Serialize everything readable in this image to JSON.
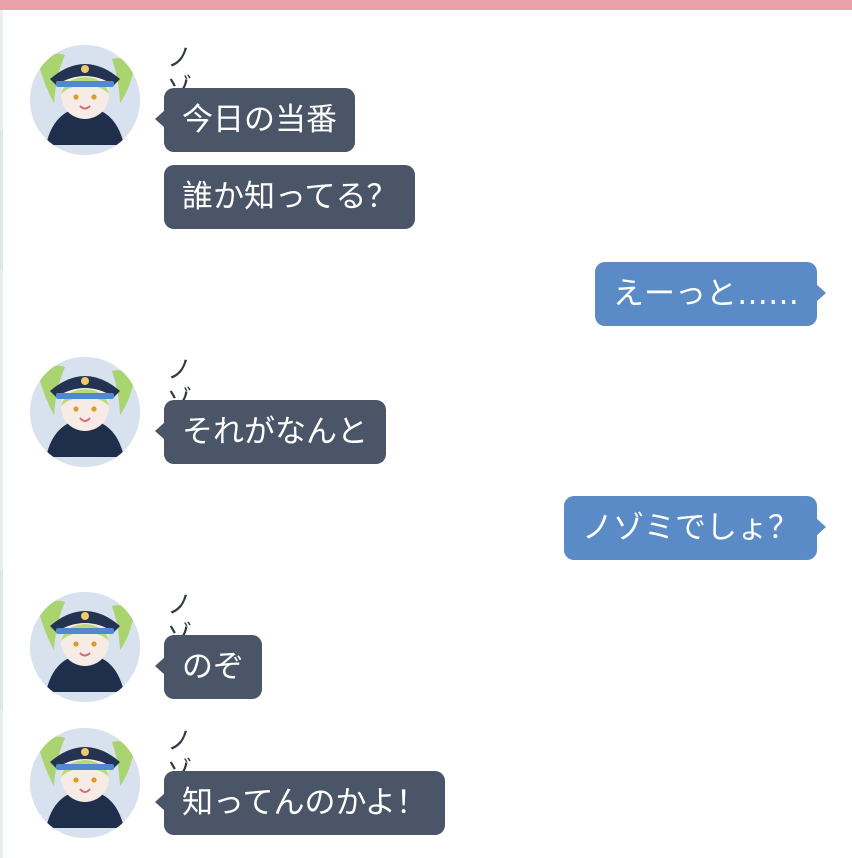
{
  "sender_name": "ノゾミ",
  "messages": [
    {
      "from": "other",
      "text": "今日の当番"
    },
    {
      "from": "other",
      "text": "誰か知ってる？"
    },
    {
      "from": "me",
      "text": "えーっと……"
    },
    {
      "from": "other",
      "text": "それがなんと"
    },
    {
      "from": "me",
      "text": "ノゾミでしょ？"
    },
    {
      "from": "other",
      "text": "のぞ"
    },
    {
      "from": "other",
      "text": "知ってんのかよ！"
    }
  ],
  "colors": {
    "header_bar": "#e8a1aa",
    "received_bubble": "#4a5567",
    "sent_bubble": "#5a8bc7",
    "name_text": "#2f3946"
  }
}
